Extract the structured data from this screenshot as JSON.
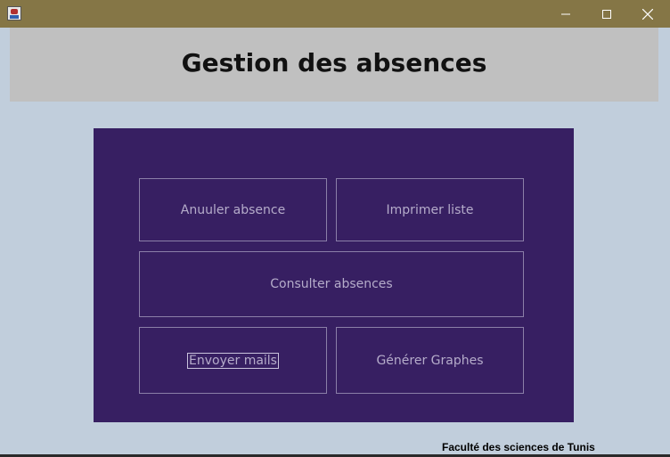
{
  "window": {
    "icon": "java-app-icon",
    "controls": [
      "minimize-icon",
      "maximize-icon",
      "close-icon"
    ]
  },
  "header": {
    "title": "Gestion des absences"
  },
  "actions": {
    "annuler": "Anuuler absence",
    "imprimer": "Imprimer liste",
    "consulter": "Consulter absences",
    "envoyer": "Envoyer mails",
    "generer": "Générer Graphes"
  },
  "footer": {
    "institution": "Faculté des sciences de Tunis"
  },
  "colors": {
    "titlebar": "#857646",
    "background": "#c1cedc",
    "header_band": "#c0c0c0",
    "panel": "#371f62",
    "button_text": "#b5acca"
  }
}
